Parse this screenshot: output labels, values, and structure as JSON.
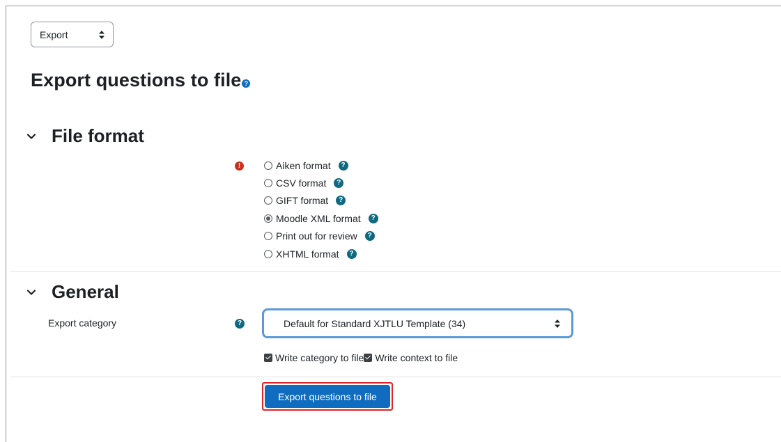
{
  "action_select": {
    "value": "Export"
  },
  "page": {
    "title": "Export questions to file",
    "title_help": "?"
  },
  "file_format": {
    "heading": "File format",
    "required_icon": "!",
    "options": [
      {
        "label": "Aiken format",
        "checked": false
      },
      {
        "label": "CSV format",
        "checked": false
      },
      {
        "label": "GIFT format",
        "checked": false
      },
      {
        "label": "Moodle XML format",
        "checked": true
      },
      {
        "label": "Print out for review",
        "checked": false
      },
      {
        "label": "XHTML format",
        "checked": false
      }
    ],
    "help_glyph": "?"
  },
  "general": {
    "heading": "General",
    "export_category_label": "Export category",
    "export_category_help": "?",
    "export_category_value": "Default for Standard XJTLU Template (34)",
    "write_category_label": "Write category to file",
    "write_category_checked": true,
    "write_context_label": "Write context to file",
    "write_context_checked": true
  },
  "submit": {
    "label": "Export questions to file"
  },
  "colors": {
    "primary_button": "#0f6cbf",
    "help_icon": "#0f6a81",
    "required_icon": "#ca3120",
    "focus_ring": "#5b9bd5",
    "highlight_border": "#e0242c"
  },
  "icons": {
    "select_arrows": "sort-arrows-icon",
    "section_toggle": "chevron-down-icon",
    "help": "question-circle-icon",
    "required": "exclamation-circle-icon"
  }
}
